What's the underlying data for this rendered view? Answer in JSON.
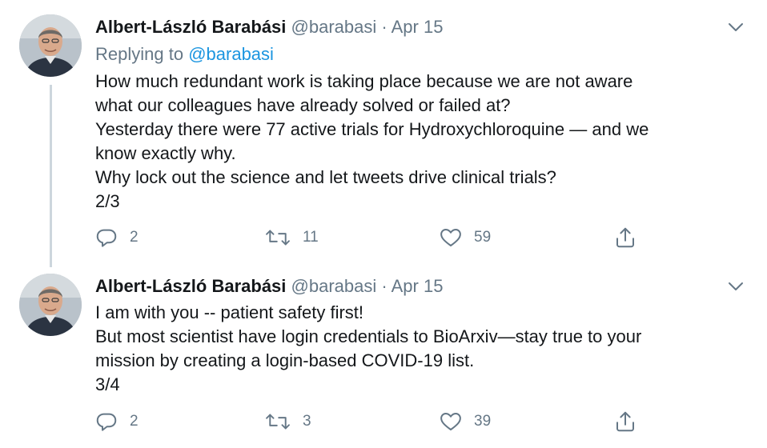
{
  "tweets": [
    {
      "author_name": "Albert-László Barabási",
      "handle": "@barabasi",
      "separator": "·",
      "date": "Apr 15",
      "reply_prefix": "Replying to",
      "reply_mention": "@barabasi",
      "body_lines": [
        "How much redundant work is taking place because we are not aware",
        "what our colleagues have already solved or failed at?",
        "Yesterday there were 77 active trials for Hydroxychloroquine  — and we",
        "know exactly why.",
        "Why lock out the science and let tweets drive clinical trials?",
        "2/3"
      ],
      "replies": "2",
      "retweets": "11",
      "likes": "59"
    },
    {
      "author_name": "Albert-László Barabási",
      "handle": "@barabasi",
      "separator": "·",
      "date": "Apr 15",
      "body_lines": [
        "I am with you -- patient safety first!",
        "But most scientist have login credentials to BioArxiv—stay true to your",
        "mission by creating a login-based COVID-19 list.",
        "3/4"
      ],
      "replies": "2",
      "retweets": "3",
      "likes": "39"
    }
  ],
  "icons": {
    "reply": "reply-icon",
    "retweet": "retweet-icon",
    "like": "heart-icon",
    "share": "share-icon",
    "more": "chevron-down-icon"
  },
  "colors": {
    "text": "#14171a",
    "secondary": "#657786",
    "link": "#1b95e0",
    "thread_line": "#cdd6dd"
  }
}
